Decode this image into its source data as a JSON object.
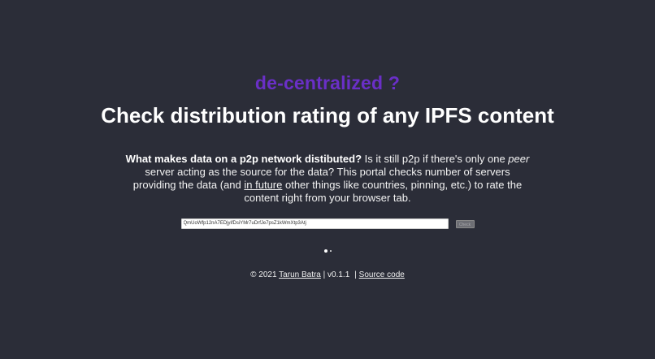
{
  "brand": {
    "title": "de-centralized ?",
    "color": "#6a2fc7"
  },
  "headline": "Check distribution rating of any IPFS content",
  "description": {
    "lead": "What makes data on a p2p network distibuted?",
    "part1": " Is it still p2p if there's only one ",
    "peer": "peer",
    "part2": " server acting as the source for the data? This portal checks number of servers providing the data (and ",
    "future_link": "in future",
    "part3": " other things like countries, pinning, etc.) to rate the content right from your browser tab."
  },
  "form": {
    "input_value": "QmUoWfp12nA7EDjyifDsiYMr7uDrfJe7psZ1kWmXtp3Atj",
    "button_label": "Check"
  },
  "footer": {
    "copyright": "© 2021",
    "author": "Tarun Batra",
    "version": "| v0.1.1",
    "divider": "|",
    "source_link": "Source code"
  },
  "colors": {
    "background": "#2b2d38",
    "text": "#ffffff"
  }
}
